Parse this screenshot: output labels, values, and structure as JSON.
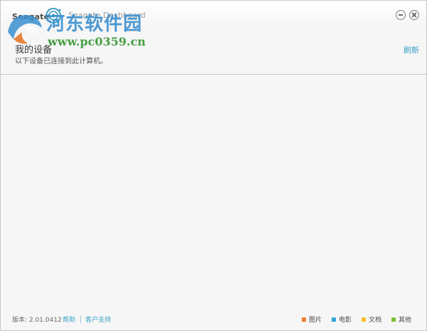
{
  "window": {
    "brand": "Seagate",
    "app_name": "Seagate Dashboard",
    "watermark_cn": "河东软件园",
    "watermark_url": "www.pc0359.cn"
  },
  "section": {
    "title": "我的设备",
    "subtitle": "以下设备已连接到此计算机。",
    "refresh_label": "刷新"
  },
  "footer": {
    "version": "版本: 2.01.0412",
    "help": "帮助",
    "support": "客户支持",
    "legend": [
      {
        "label": "图片",
        "color": "#f07f2a"
      },
      {
        "label": "电影",
        "color": "#36a8e0"
      },
      {
        "label": "文档",
        "color": "#f5c02a"
      },
      {
        "label": "其他",
        "color": "#7cc13a"
      }
    ]
  },
  "colors": {
    "accent": "#3aa0c8",
    "background": "#f6f6f6"
  }
}
